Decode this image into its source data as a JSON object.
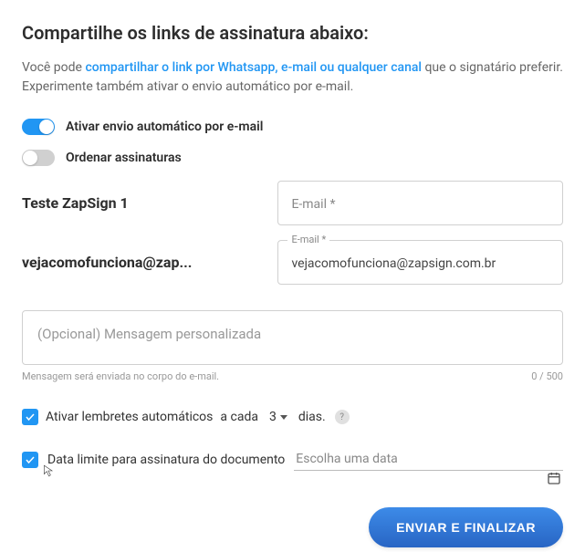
{
  "heading": "Compartilhe os links de assinatura abaixo:",
  "intro": {
    "prefix": "Você pode ",
    "link": "compartilhar o link por Whatsapp, e-mail ou qualquer canal",
    "suffix": " que o signatário preferir. Experimente também ativar o envio automático por e-mail."
  },
  "toggles": {
    "auto_email": {
      "label": "Ativar envio automático por e-mail",
      "on": true
    },
    "order_signatures": {
      "label": "Ordenar assinaturas",
      "on": false
    }
  },
  "signers": [
    {
      "name": "Teste ZapSign 1",
      "email_label": "E-mail *",
      "email_value": ""
    },
    {
      "name": "vejacomofunciona@zap...",
      "email_label": "E-mail *",
      "email_value": "vejacomofunciona@zapsign.com.br"
    }
  ],
  "message": {
    "placeholder": "(Opcional) Mensagem personalizada",
    "hint": "Mensagem será enviada no corpo do e-mail.",
    "counter": "0 / 500"
  },
  "reminders": {
    "label_prefix": "Ativar lembretes automáticos",
    "every": "a cada",
    "value": "3",
    "unit": "dias."
  },
  "deadline": {
    "label": "Data limite para assinatura do documento",
    "placeholder": "Escolha uma data"
  },
  "submit": "ENVIAR E FINALIZAR"
}
